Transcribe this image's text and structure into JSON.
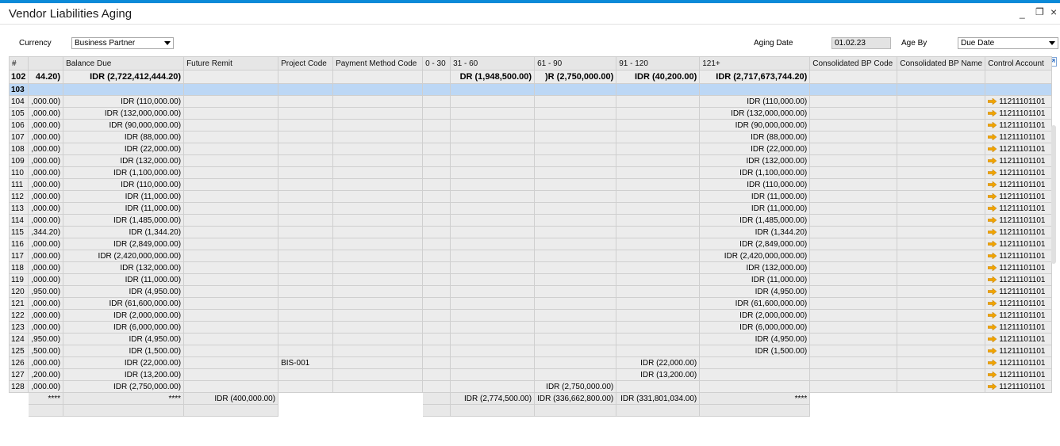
{
  "window": {
    "title": "Vendor Liabilities Aging",
    "minimize": "_",
    "restore": "❐",
    "close": "×"
  },
  "filters": {
    "currency_label": "Currency",
    "currency_value": "Business Partner",
    "aging_date_label": "Aging Date",
    "aging_date_value": "01.02.23",
    "age_by_label": "Age By",
    "age_by_value": "Due Date"
  },
  "table": {
    "headers": [
      "#",
      "",
      "Balance Due",
      "Future Remit",
      "Project Code",
      "Payment Method Code",
      "0 - 30",
      "31 - 60",
      "61 - 90",
      "91 - 120",
      "121+",
      "Consolidated BP Code",
      "Consolidated BP Name",
      "Control Account"
    ],
    "summary_row": {
      "num": "102",
      "c1": "44.20)",
      "balance": "IDR (2,722,412,444.20)",
      "d31": "DR (1,948,500.00)",
      "d61": ")R (2,750,000.00)",
      "d91": "IDR (40,200.00)",
      "d121": "IDR (2,717,673,744.20)"
    },
    "selected_row": {
      "num": "103"
    },
    "rows": [
      {
        "n": "104",
        "c1": ",000.00)",
        "bal": "IDR (110,000.00)",
        "proj": "",
        "d61": "",
        "d91": "",
        "d121": "IDR (110,000.00)",
        "acct": "11211101101"
      },
      {
        "n": "105",
        "c1": ",000.00)",
        "bal": "IDR (132,000,000.00)",
        "proj": "",
        "d61": "",
        "d91": "",
        "d121": "IDR (132,000,000.00)",
        "acct": "11211101101"
      },
      {
        "n": "106",
        "c1": ",000.00)",
        "bal": "IDR (90,000,000.00)",
        "proj": "",
        "d61": "",
        "d91": "",
        "d121": "IDR (90,000,000.00)",
        "acct": "11211101101"
      },
      {
        "n": "107",
        "c1": ",000.00)",
        "bal": "IDR (88,000.00)",
        "proj": "",
        "d61": "",
        "d91": "",
        "d121": "IDR (88,000.00)",
        "acct": "11211101101"
      },
      {
        "n": "108",
        "c1": ",000.00)",
        "bal": "IDR (22,000.00)",
        "proj": "",
        "d61": "",
        "d91": "",
        "d121": "IDR (22,000.00)",
        "acct": "11211101101"
      },
      {
        "n": "109",
        "c1": ",000.00)",
        "bal": "IDR (132,000.00)",
        "proj": "",
        "d61": "",
        "d91": "",
        "d121": "IDR (132,000.00)",
        "acct": "11211101101"
      },
      {
        "n": "110",
        "c1": ",000.00)",
        "bal": "IDR (1,100,000.00)",
        "proj": "",
        "d61": "",
        "d91": "",
        "d121": "IDR (1,100,000.00)",
        "acct": "11211101101"
      },
      {
        "n": "111",
        "c1": ",000.00)",
        "bal": "IDR (110,000.00)",
        "proj": "",
        "d61": "",
        "d91": "",
        "d121": "IDR (110,000.00)",
        "acct": "11211101101"
      },
      {
        "n": "112",
        "c1": ",000.00)",
        "bal": "IDR (11,000.00)",
        "proj": "",
        "d61": "",
        "d91": "",
        "d121": "IDR (11,000.00)",
        "acct": "11211101101"
      },
      {
        "n": "113",
        "c1": ",000.00)",
        "bal": "IDR (11,000.00)",
        "proj": "",
        "d61": "",
        "d91": "",
        "d121": "IDR (11,000.00)",
        "acct": "11211101101"
      },
      {
        "n": "114",
        "c1": ",000.00)",
        "bal": "IDR (1,485,000.00)",
        "proj": "",
        "d61": "",
        "d91": "",
        "d121": "IDR (1,485,000.00)",
        "acct": "11211101101"
      },
      {
        "n": "115",
        "c1": ",344.20)",
        "bal": "IDR (1,344.20)",
        "proj": "",
        "d61": "",
        "d91": "",
        "d121": "IDR (1,344.20)",
        "acct": "11211101101"
      },
      {
        "n": "116",
        "c1": ",000.00)",
        "bal": "IDR (2,849,000.00)",
        "proj": "",
        "d61": "",
        "d91": "",
        "d121": "IDR (2,849,000.00)",
        "acct": "11211101101"
      },
      {
        "n": "117",
        "c1": ",000.00)",
        "bal": "IDR (2,420,000,000.00)",
        "proj": "",
        "d61": "",
        "d91": "",
        "d121": "IDR (2,420,000,000.00)",
        "acct": "11211101101"
      },
      {
        "n": "118",
        "c1": ",000.00)",
        "bal": "IDR (132,000.00)",
        "proj": "",
        "d61": "",
        "d91": "",
        "d121": "IDR (132,000.00)",
        "acct": "11211101101"
      },
      {
        "n": "119",
        "c1": ",000.00)",
        "bal": "IDR (11,000.00)",
        "proj": "",
        "d61": "",
        "d91": "",
        "d121": "IDR (11,000.00)",
        "acct": "11211101101"
      },
      {
        "n": "120",
        "c1": ",950.00)",
        "bal": "IDR (4,950.00)",
        "proj": "",
        "d61": "",
        "d91": "",
        "d121": "IDR (4,950.00)",
        "acct": "11211101101"
      },
      {
        "n": "121",
        "c1": ",000.00)",
        "bal": "IDR (61,600,000.00)",
        "proj": "",
        "d61": "",
        "d91": "",
        "d121": "IDR (61,600,000.00)",
        "acct": "11211101101"
      },
      {
        "n": "122",
        "c1": ",000.00)",
        "bal": "IDR (2,000,000.00)",
        "proj": "",
        "d61": "",
        "d91": "",
        "d121": "IDR (2,000,000.00)",
        "acct": "11211101101"
      },
      {
        "n": "123",
        "c1": ",000.00)",
        "bal": "IDR (6,000,000.00)",
        "proj": "",
        "d61": "",
        "d91": "",
        "d121": "IDR (6,000,000.00)",
        "acct": "11211101101"
      },
      {
        "n": "124",
        "c1": ",950.00)",
        "bal": "IDR (4,950.00)",
        "proj": "",
        "d61": "",
        "d91": "",
        "d121": "IDR (4,950.00)",
        "acct": "11211101101"
      },
      {
        "n": "125",
        "c1": ",500.00)",
        "bal": "IDR (1,500.00)",
        "proj": "",
        "d61": "",
        "d91": "",
        "d121": "IDR (1,500.00)",
        "acct": "11211101101"
      },
      {
        "n": "126",
        "c1": ",000.00)",
        "bal": "IDR (22,000.00)",
        "proj": "BIS-001",
        "d61": "",
        "d91": "IDR (22,000.00)",
        "d121": "",
        "acct": "11211101101"
      },
      {
        "n": "127",
        "c1": ",200.00)",
        "bal": "IDR (13,200.00)",
        "proj": "",
        "d61": "",
        "d91": "IDR (13,200.00)",
        "d121": "",
        "acct": "11211101101"
      },
      {
        "n": "128",
        "c1": ",000.00)",
        "bal": "IDR (2,750,000.00)",
        "proj": "",
        "d61": "IDR (2,750,000.00)",
        "d91": "",
        "d121": "",
        "acct": "11211101101"
      }
    ],
    "totals": {
      "c1": "****",
      "bal": "****",
      "future": "IDR (400,000.00)",
      "d31": "IDR (2,774,500.00)",
      "d61": "IDR (336,662,800.00)",
      "d91": "IDR (331,801,034.00)",
      "d121": "****"
    }
  },
  "colors": {
    "accent": "#0b8ad8",
    "selected_row": "#bcd7f5",
    "link_arrow": "#f0a400"
  }
}
